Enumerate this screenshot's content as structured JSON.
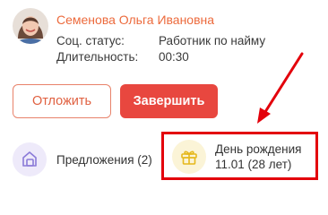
{
  "customer": {
    "name": "Семенова Ольга Ивановна",
    "social_status_label": "Соц. статус:",
    "social_status_value": "Работник по найму",
    "duration_label": "Длительность:",
    "duration_value": "00:30"
  },
  "actions": {
    "postpone_label": "Отложить",
    "finish_label": "Завершить"
  },
  "offers": {
    "label": "Предложения (2)",
    "icon": "offers-icon"
  },
  "birthday": {
    "title": "День рождения",
    "date": "11.01 (28 лет)",
    "icon": "gift-icon"
  },
  "colors": {
    "accent_orange": "#ec6a3c",
    "finish_red": "#e8473f",
    "highlight_red": "#e3000b",
    "offers_purple": "#8b7bd8",
    "gift_yellow": "#e6b81c"
  }
}
